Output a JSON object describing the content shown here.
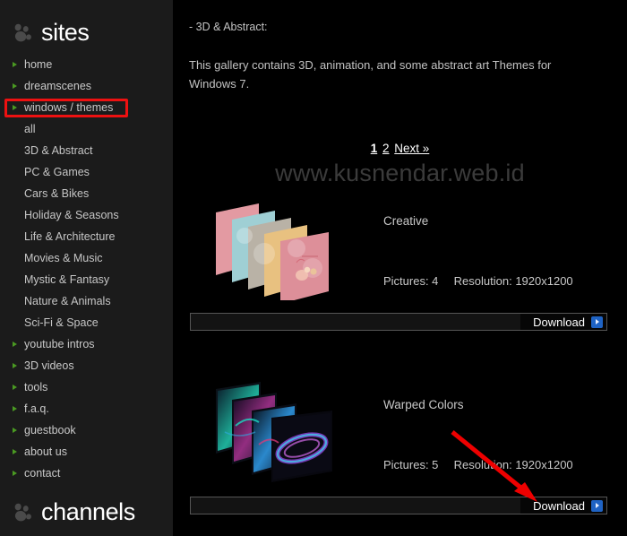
{
  "sidebar": {
    "brand": {
      "label": "sites",
      "icon": "paw-logo-icon"
    },
    "items": [
      {
        "label": "home",
        "level": "top",
        "icon": "green-triangle-icon"
      },
      {
        "label": "dreamscenes",
        "level": "top",
        "icon": "green-triangle-icon"
      },
      {
        "label": "windows / themes",
        "level": "top",
        "icon": "green-triangle-icon",
        "highlighted": true
      },
      {
        "label": "all",
        "level": "sub"
      },
      {
        "label": "3D & Abstract",
        "level": "sub"
      },
      {
        "label": "PC & Games",
        "level": "sub"
      },
      {
        "label": "Cars & Bikes",
        "level": "sub"
      },
      {
        "label": "Holiday & Seasons",
        "level": "sub"
      },
      {
        "label": "Life & Architecture",
        "level": "sub"
      },
      {
        "label": "Movies & Music",
        "level": "sub"
      },
      {
        "label": "Mystic & Fantasy",
        "level": "sub"
      },
      {
        "label": "Nature & Animals",
        "level": "sub"
      },
      {
        "label": "Sci-Fi & Space",
        "level": "sub"
      },
      {
        "label": "youtube intros",
        "level": "top",
        "icon": "green-triangle-icon"
      },
      {
        "label": "3D videos",
        "level": "top",
        "icon": "green-triangle-icon"
      },
      {
        "label": "tools",
        "level": "top",
        "icon": "green-triangle-icon"
      },
      {
        "label": "f.a.q.",
        "level": "top",
        "icon": "green-triangle-icon"
      },
      {
        "label": "guestbook",
        "level": "top",
        "icon": "green-triangle-icon"
      },
      {
        "label": "about us",
        "level": "top",
        "icon": "green-triangle-icon"
      },
      {
        "label": "contact",
        "level": "top",
        "icon": "green-triangle-icon"
      }
    ],
    "channels": {
      "label": "channels",
      "icon": "paw-logo-icon"
    }
  },
  "main": {
    "heading": "- 3D & Abstract:",
    "description": "This gallery contains 3D, animation, and some abstract art Themes for Windows 7.",
    "watermark": "www.kusnendar.web.id",
    "pagination": {
      "pages": [
        {
          "label": "1",
          "current": true
        },
        {
          "label": "2",
          "current": false
        }
      ],
      "next_label": "Next »"
    },
    "gallery": [
      {
        "title": "Creative",
        "pictures_label": "Pictures: 4",
        "resolution_label": "Resolution: 1920x1200",
        "download_label": "Download",
        "download_icon": "blue-arrow-icon",
        "thumb": "pastel-theme-stack-thumbnail"
      },
      {
        "title": "Warped Colors",
        "pictures_label": "Pictures: 5",
        "resolution_label": "Resolution: 1920x1200",
        "download_label": "Download",
        "download_icon": "blue-arrow-icon",
        "thumb": "neon-swirl-theme-stack-thumbnail"
      }
    ]
  },
  "annotations": {
    "highlight_box": {
      "target": "windows / themes",
      "color": "#ee1111"
    },
    "arrow": {
      "target": "Download",
      "color": "#ee0000"
    }
  },
  "colors": {
    "page_background": "#000000",
    "sidebar_background": "#1b1b1b",
    "nav_bullet_green": "#4a9a22",
    "text_grey": "#c3c3c3",
    "download_blue": "#1f63c4",
    "annotation_red": "#ee1111",
    "watermark_grey": "#3b3b3b"
  }
}
